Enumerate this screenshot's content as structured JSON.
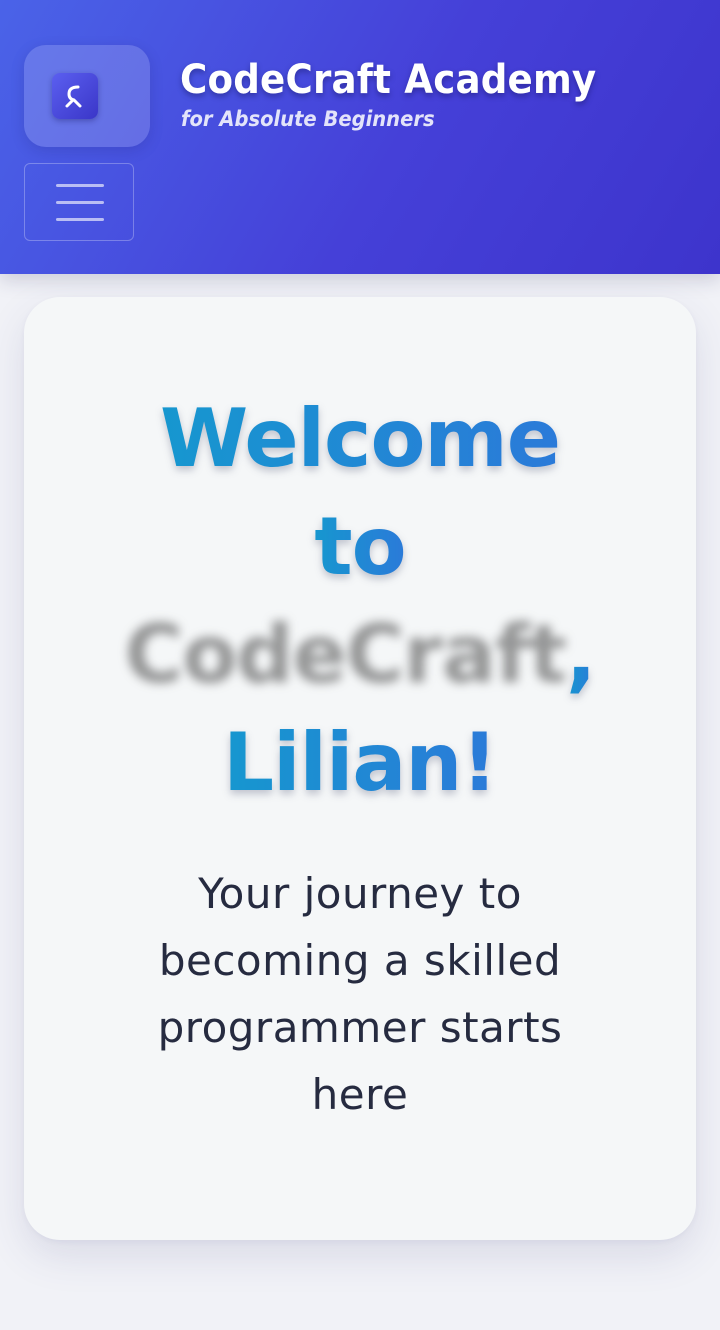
{
  "header": {
    "title": "CodeCraft Academy",
    "subtitle": "for Absolute Beginners",
    "logo_icon": "code-craft-logo-icon",
    "menu_icon": "hamburger-menu-icon",
    "gradient_start": "#4a63e8",
    "gradient_end": "#3d34cc"
  },
  "hero": {
    "heading_line1": "Welcome",
    "heading_line2": "to",
    "heading_line3_blurred": "CodeCraft",
    "heading_line3_comma": ",",
    "heading_line4": "Lilian!",
    "tagline_line1": "Your journey to",
    "tagline_line2": "becoming a skilled",
    "tagline_line3": "programmer starts",
    "tagline_line4": "here",
    "heading_gradient_start": "#1697cf",
    "heading_gradient_end": "#2b7ad9",
    "tagline_color": "#262b40"
  }
}
